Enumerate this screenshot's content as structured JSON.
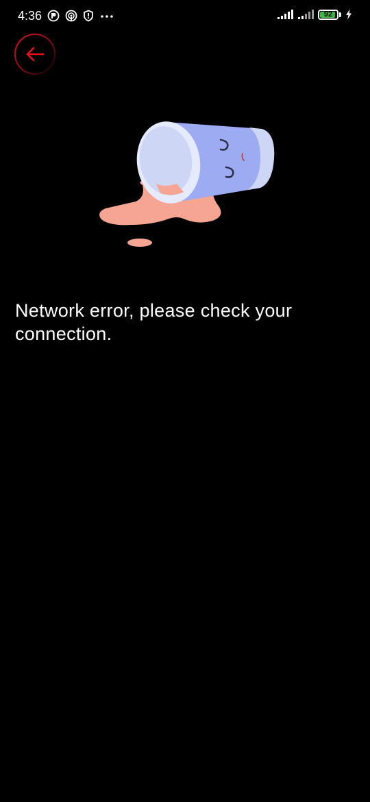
{
  "status_bar": {
    "time": "4:36",
    "battery_level": "92",
    "battery_fraction": 0.92,
    "battery_color": "#3fb73f",
    "left_icons": [
      "app-notification-icon",
      "podcast-icon",
      "shield-icon",
      "more-dots-icon"
    ],
    "right_icons": [
      "signal-icon",
      "signal-icon",
      "battery-icon",
      "charging-bolt-icon"
    ]
  },
  "header": {
    "back_icon": "arrow-left-icon",
    "accent_color": "#e5121b"
  },
  "illustration": {
    "icon": "spilled-cup-icon",
    "colors": {
      "cup_body": "#9dabf2",
      "cup_rim": "#e5eaff",
      "cup_inside": "#cdd6f5",
      "spill": "#f7a593"
    }
  },
  "main": {
    "error_message": "Network error, please check your connection."
  }
}
